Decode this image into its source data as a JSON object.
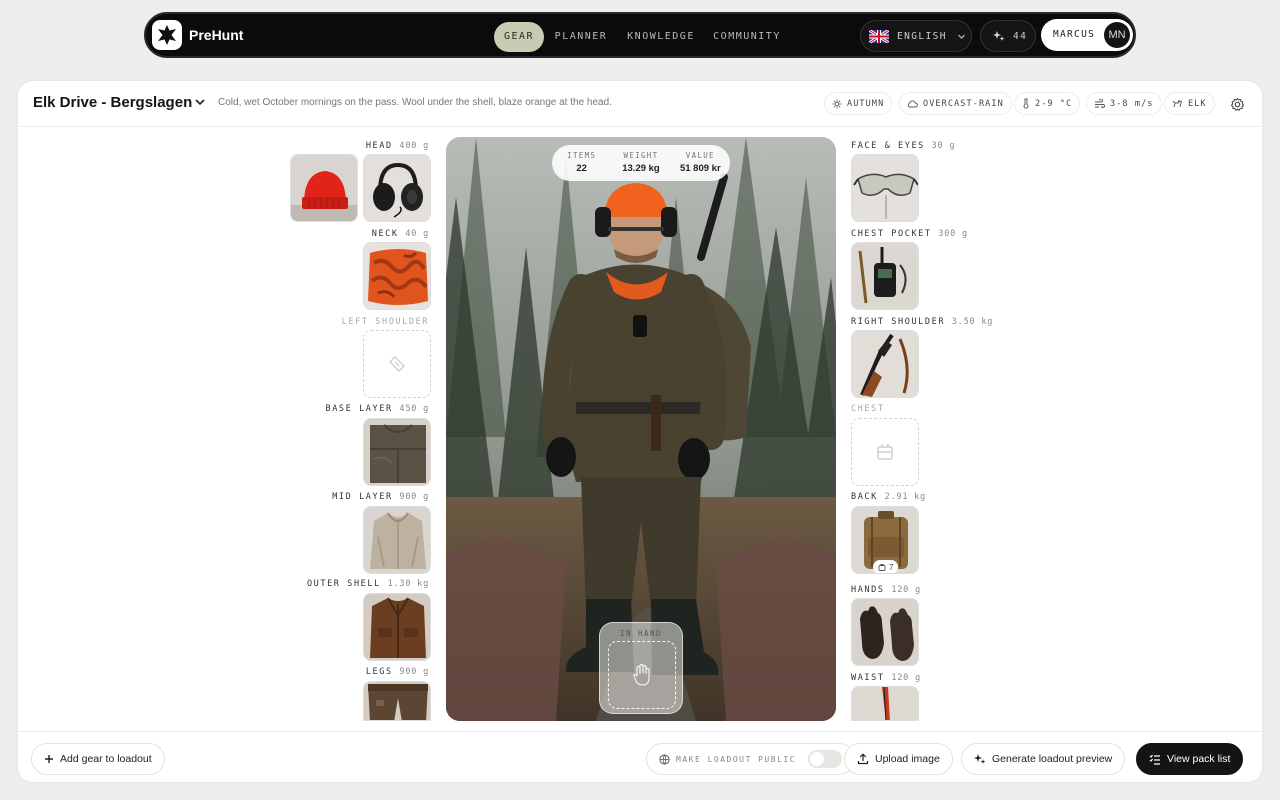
{
  "nav": {
    "brand": "PreHunt",
    "tabs": [
      "GEAR",
      "PLANNER",
      "KNOWLEDGE",
      "COMMUNITY"
    ],
    "active_tab": "GEAR",
    "language": "ENGLISH",
    "points": "44",
    "user": {
      "name": "MARCUS",
      "initials": "MN"
    }
  },
  "loadout": {
    "title": "Elk Drive - Bergslagen",
    "description": "Cold, wet October mornings on the pass. Wool under the shell, blaze orange at the head."
  },
  "conditions": {
    "season": "AUTUMN",
    "weather": "OVERCAST-RAIN",
    "temperature": "2-9 °C",
    "wind": "3-8 m/s",
    "game": "ELK"
  },
  "stats": {
    "items_label": "ITEMS",
    "items": "22",
    "weight_label": "WEIGHT",
    "weight": "13.29 kg",
    "value_label": "VALUE",
    "value": "51 809 kr"
  },
  "left_slots": {
    "head": {
      "name": "HEAD",
      "weight": "400 g"
    },
    "neck": {
      "name": "NECK",
      "weight": "40 g"
    },
    "left_shoulder": {
      "name": "LEFT SHOULDER",
      "weight": ""
    },
    "base_layer": {
      "name": "BASE LAYER",
      "weight": "450 g"
    },
    "mid_layer": {
      "name": "MID LAYER",
      "weight": "900 g"
    },
    "outer_shell": {
      "name": "OUTER SHELL",
      "weight": "1.30 kg"
    },
    "legs": {
      "name": "LEGS",
      "weight": "900 g"
    }
  },
  "right_slots": {
    "face_eyes": {
      "name": "FACE & EYES",
      "weight": "30 g"
    },
    "chest_pocket": {
      "name": "CHEST POCKET",
      "weight": "300 g"
    },
    "right_shoulder": {
      "name": "RIGHT SHOULDER",
      "weight": "3.50 kg"
    },
    "chest": {
      "name": "CHEST",
      "weight": ""
    },
    "back": {
      "name": "BACK",
      "weight": "2.91 kg",
      "contents_count": "7"
    },
    "hands": {
      "name": "HANDS",
      "weight": "120 g"
    },
    "waist": {
      "name": "WAIST",
      "weight": "120 g"
    }
  },
  "in_hand_label": "IN HAND",
  "footer": {
    "add_gear": "Add gear to loadout",
    "make_public": "MAKE LOADOUT PUBLIC",
    "make_public_on": false,
    "upload": "Upload image",
    "generate": "Generate loadout preview",
    "pack_list": "View pack list"
  }
}
